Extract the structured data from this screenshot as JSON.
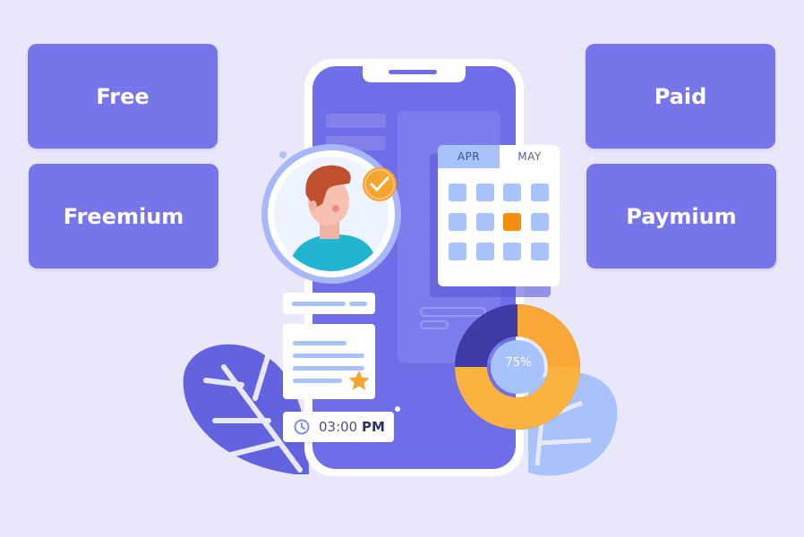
{
  "plans": {
    "free": "Free",
    "freemium": "Freemium",
    "paid": "Paid",
    "paymium": "Paymium"
  },
  "calendar": {
    "month_1": "APR",
    "month_2": "MAY"
  },
  "donut": {
    "percent_label": "75%",
    "percent_value": 75
  },
  "time": {
    "value": "03:00",
    "meridiem": "PM"
  },
  "colors": {
    "background": "#e9e8fb",
    "card": "#7676ea",
    "phone": "#6f6ee8",
    "accent_orange": "#f7a531",
    "light_blue": "#a8c3fb"
  },
  "icons": [
    "check-icon",
    "star-icon",
    "clock-icon",
    "avatar"
  ]
}
